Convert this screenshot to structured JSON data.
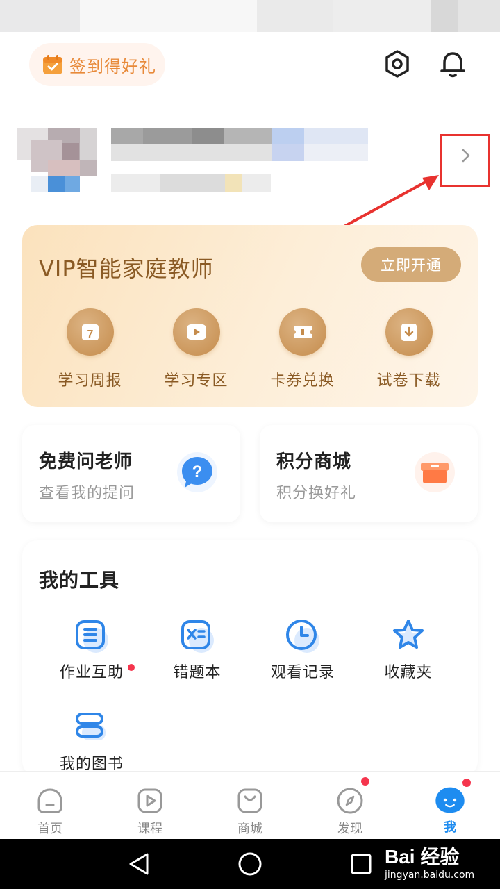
{
  "header": {
    "checkin_label": "签到得好礼"
  },
  "vip": {
    "title": "VIP智能家庭教师",
    "button": "立即开通",
    "items": [
      {
        "label": "学习周报",
        "icon": "calendar-7-icon"
      },
      {
        "label": "学习专区",
        "icon": "play-icon"
      },
      {
        "label": "卡券兑换",
        "icon": "ticket-icon"
      },
      {
        "label": "试卷下载",
        "icon": "download-icon"
      }
    ]
  },
  "cards": {
    "ask": {
      "title": "免费问老师",
      "subtitle": "查看我的提问",
      "icon": "question-bubble-icon"
    },
    "points": {
      "title": "积分商城",
      "subtitle": "积分换好礼",
      "icon": "gift-box-icon"
    }
  },
  "tools": {
    "title": "我的工具",
    "items": [
      {
        "label": "作业互助",
        "icon": "homework-icon",
        "has_dot": true
      },
      {
        "label": "错题本",
        "icon": "wrong-questions-icon"
      },
      {
        "label": "观看记录",
        "icon": "clock-icon"
      },
      {
        "label": "收藏夹",
        "icon": "star-icon"
      },
      {
        "label": "我的图书",
        "icon": "books-icon"
      }
    ]
  },
  "tabbar": {
    "tabs": [
      {
        "label": "首页",
        "icon": "home-icon"
      },
      {
        "label": "课程",
        "icon": "play-icon"
      },
      {
        "label": "商城",
        "icon": "shop-bag-icon"
      },
      {
        "label": "发现",
        "icon": "compass-icon",
        "badge": true
      },
      {
        "label": "我",
        "icon": "mascot-icon",
        "badge": true,
        "active": true
      }
    ]
  },
  "watermark": {
    "brand": "Bai 经验",
    "url": "jingyan.baidu.com"
  },
  "colors": {
    "accent_blue": "#1e8cf0",
    "vip_brown": "#8a5a24",
    "vip_button": "#d4ab78",
    "highlight_red": "#e8322f",
    "checkin_orange": "#e88a3a"
  }
}
